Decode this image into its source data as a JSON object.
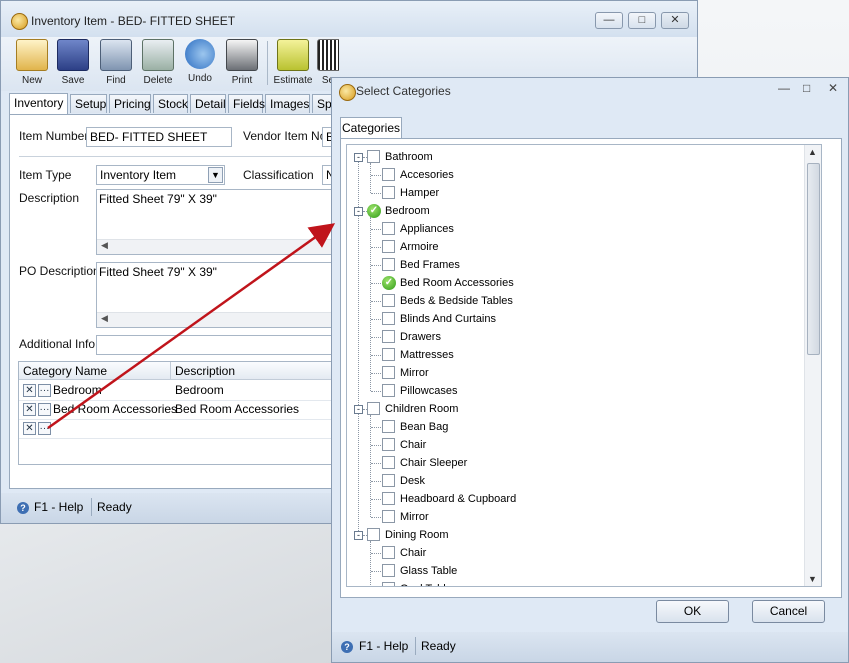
{
  "main_window": {
    "title": "Inventory Item - BED- FITTED SHEET",
    "toolbar": [
      "New",
      "Save",
      "Find",
      "Delete",
      "Undo",
      "Print",
      "Estimate",
      "Se"
    ],
    "tabs": [
      "Inventory",
      "Setup",
      "Pricing",
      "Stock",
      "Detail",
      "Fields",
      "Images",
      "Spe"
    ],
    "item_number_label": "Item Number",
    "item_number_value": "BED- FITTED SHEET",
    "vendor_item_label": "Vendor Item No",
    "vendor_item_value": "B",
    "item_type_label": "Item Type",
    "item_type_value": "Inventory Item",
    "classification_label": "Classification",
    "classification_value": "N",
    "description_label": "Description",
    "description_value": "Fitted Sheet 79\" X 39\"",
    "po_description_label": "PO Description",
    "po_description_value": "Fitted Sheet 79\" X 39\"",
    "additional_info_label": "Additional Info",
    "grid_headers": [
      "Category Name",
      "Description"
    ],
    "grid_rows": [
      {
        "name": "Bedroom",
        "description": "Bedroom"
      },
      {
        "name": "Bed Room Accessories",
        "description": "Bed Room Accessories"
      }
    ],
    "status_help": "F1 - Help",
    "status_text": "Ready"
  },
  "dialog": {
    "title": "Select Categories",
    "tab": "Categories",
    "tree": [
      {
        "label": "Bathroom",
        "level": 0,
        "checked": false
      },
      {
        "label": "Accesories",
        "level": 1,
        "checked": false
      },
      {
        "label": "Hamper",
        "level": 1,
        "checked": false
      },
      {
        "label": "Bedroom",
        "level": 0,
        "checked": true
      },
      {
        "label": "Appliances",
        "level": 1,
        "checked": false
      },
      {
        "label": "Armoire",
        "level": 1,
        "checked": false
      },
      {
        "label": "Bed Frames",
        "level": 1,
        "checked": false
      },
      {
        "label": "Bed Room Accessories",
        "level": 1,
        "checked": true
      },
      {
        "label": "Beds & Bedside Tables",
        "level": 1,
        "checked": false
      },
      {
        "label": "Blinds And Curtains",
        "level": 1,
        "checked": false
      },
      {
        "label": "Drawers",
        "level": 1,
        "checked": false
      },
      {
        "label": "Mattresses",
        "level": 1,
        "checked": false
      },
      {
        "label": "Mirror",
        "level": 1,
        "checked": false
      },
      {
        "label": "Pillowcases",
        "level": 1,
        "checked": false
      },
      {
        "label": "Children Room",
        "level": 0,
        "checked": false
      },
      {
        "label": "Bean Bag",
        "level": 1,
        "checked": false
      },
      {
        "label": "Chair",
        "level": 1,
        "checked": false
      },
      {
        "label": "Chair Sleeper",
        "level": 1,
        "checked": false
      },
      {
        "label": "Desk",
        "level": 1,
        "checked": false
      },
      {
        "label": "Headboard & Cupboard",
        "level": 1,
        "checked": false
      },
      {
        "label": "Mirror",
        "level": 1,
        "checked": false
      },
      {
        "label": "Dining Room",
        "level": 0,
        "checked": false
      },
      {
        "label": "Chair",
        "level": 1,
        "checked": false
      },
      {
        "label": "Glass Table",
        "level": 1,
        "checked": false
      },
      {
        "label": "Oval Table",
        "level": 1,
        "checked": false
      }
    ],
    "ok": "OK",
    "cancel": "Cancel",
    "status_help": "F1 - Help",
    "status_text": "Ready"
  },
  "colors": {
    "arrow": "#c0141b",
    "check": "#2f9b18"
  }
}
